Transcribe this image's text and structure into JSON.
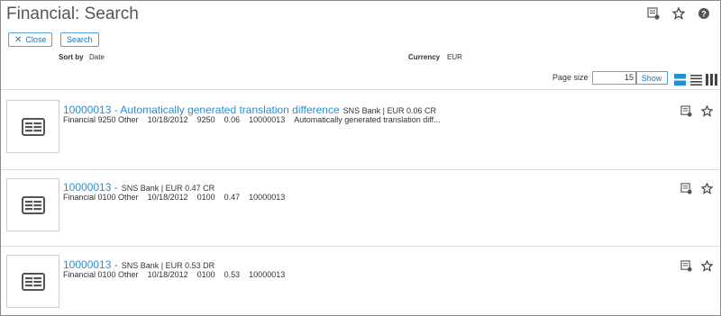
{
  "page": {
    "title": "Financial: Search"
  },
  "toolbar": {
    "close_label": "Close",
    "search_label": "Search"
  },
  "filters": {
    "sort_by_label": "Sort by",
    "sort_by_value": "Date",
    "currency_label": "Currency",
    "currency_value": "EUR"
  },
  "paging": {
    "page_size_label": "Page size",
    "page_size_value": "15",
    "show_label": "Show"
  },
  "results": [
    {
      "id": "10000013",
      "title": "10000013 - Automatically generated translation difference",
      "meta": "SNS Bank | EUR 0.06 CR",
      "type": "Financial 9250 Other",
      "date": "10/18/2012",
      "account": "9250",
      "amount": "0.06",
      "ref": "10000013",
      "description": "Automatically generated translation diff..."
    },
    {
      "id": "10000013",
      "title": "10000013 -",
      "meta": "SNS Bank | EUR 0.47 CR",
      "type": "Financial 0100 Other",
      "date": "10/18/2012",
      "account": "0100",
      "amount": "0.47",
      "ref": "10000013",
      "description": ""
    },
    {
      "id": "10000013",
      "title": "10000013 -",
      "meta": "SNS Bank | EUR 0.53 DR",
      "type": "Financial 0100 Other",
      "date": "10/18/2012",
      "account": "0100",
      "amount": "0.53",
      "ref": "10000013",
      "description": ""
    }
  ],
  "colors": {
    "accent": "#2a8fcf",
    "view_active": "#2a8fcf",
    "icon": "#444444"
  },
  "icons": {
    "top": [
      "list-settings-icon",
      "star-icon",
      "help-icon"
    ],
    "views": [
      "tile-view-icon",
      "list-view-icon",
      "column-view-icon"
    ]
  }
}
